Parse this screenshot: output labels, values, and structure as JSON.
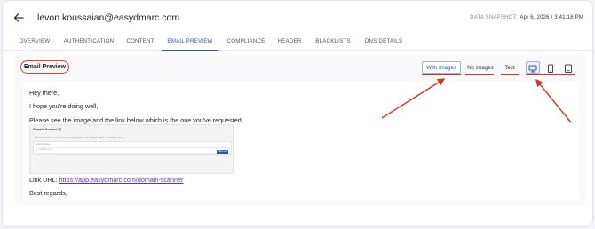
{
  "header": {
    "title": "levon.koussaian@easydmarc.com",
    "snapshot_label": "DATA SNAPSHOT:",
    "snapshot_value": "Apr 6, 2026 / 3:41:18 PM"
  },
  "tabs": [
    {
      "label": "OVERVIEW"
    },
    {
      "label": "AUTHENTICATION"
    },
    {
      "label": "CONTENT"
    },
    {
      "label": "EMAIL PREVIEW",
      "active": true
    },
    {
      "label": "COMPLIANCE"
    },
    {
      "label": "HEADER"
    },
    {
      "label": "BLACKLISTS"
    },
    {
      "label": "DNS DETAILS"
    }
  ],
  "section": {
    "title": "Email Preview",
    "view_buttons": [
      "With images",
      "No images",
      "Text"
    ],
    "selected_view": "With images",
    "devices": [
      "desktop-icon",
      "mobile-icon",
      "tablet-icon"
    ],
    "selected_device": "desktop-icon"
  },
  "email": {
    "greeting": "Hey there,",
    "line1": "I hope you're doing well,",
    "line2": "Please see the image and the link below which is the one you've requested.",
    "link_prefix": "Link URL: ",
    "link_text": "https://app.easydmarc.com/domain-scanner",
    "signoff": "Best regards,"
  },
  "thumbnail": {
    "title": "Domain Scanner",
    "description": "Check a domain's security for phishing: reliability with DMARC, SPF, and DKIM records.",
    "field_label": "Domain Name",
    "field_placeholder": "example.com",
    "button_label": "Scan now"
  },
  "colors": {
    "accent": "#2d55b4",
    "annotation": "#d9341e",
    "link": "#5b34a8"
  }
}
